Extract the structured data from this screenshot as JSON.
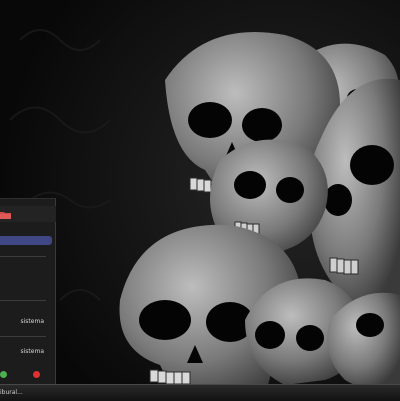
{
  "desktop": {
    "wallpaper": "skulls",
    "accent": "#3f4785"
  },
  "start_menu": {
    "items": [
      {
        "label": "sistema"
      },
      {
        "label": "sistema"
      }
    ],
    "power_buttons": [
      {
        "icon": "green-dot-icon",
        "color": "#4caf50"
      },
      {
        "icon": "red-dot-icon",
        "color": "#e03030"
      }
    ]
  },
  "taskbar": {
    "task_label": "ibural..."
  }
}
